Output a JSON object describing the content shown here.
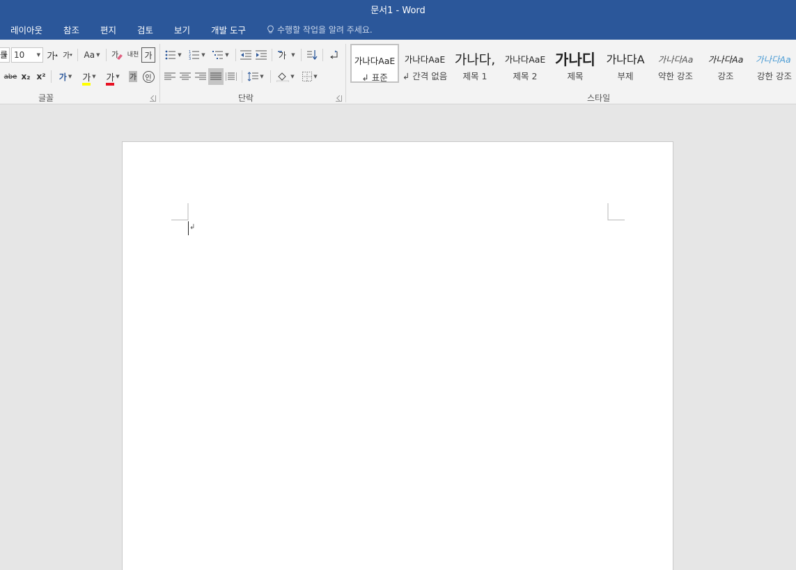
{
  "window": {
    "title": "문서1 - Word"
  },
  "menu": {
    "items": [
      "레이아웃",
      "참조",
      "편지",
      "검토",
      "보기",
      "개발 도구"
    ],
    "tell_me": "수행할 작업을 알려 주세요."
  },
  "font_group": {
    "label": "글꼴",
    "font_size": "10",
    "font_name_partial": "를",
    "grow_label": "가",
    "shrink_label": "가",
    "case_label": "Aa",
    "phonetic_label": "내천",
    "enclose_label": "가",
    "strike_label": "abe",
    "sub_label": "x₂",
    "sup_label": "x²",
    "text_effect_label": "가",
    "highlight_label": "가",
    "font_color_label": "가",
    "shading_label": "가",
    "circle_label": "인"
  },
  "paragraph_group": {
    "label": "단락"
  },
  "styles_group": {
    "label": "스타일",
    "items": [
      {
        "sample": "가나다AaE",
        "name": "↲ 표준"
      },
      {
        "sample": "가나다AaE",
        "name": "↲ 간격 없음"
      },
      {
        "sample": "가나다,",
        "name": "제목 1"
      },
      {
        "sample": "가나다AaE",
        "name": "제목 2"
      },
      {
        "sample": "가나디",
        "name": "제목"
      },
      {
        "sample": "가나다A",
        "name": "부제"
      },
      {
        "sample": "가나다Aa",
        "name": "약한 강조"
      },
      {
        "sample": "가나다Aa",
        "name": "강조"
      },
      {
        "sample": "가나다Aa",
        "name": "강한 강조"
      }
    ]
  },
  "colors": {
    "brand": "#2b579a",
    "highlight": "#ffff00",
    "font_color": "#e81123",
    "intense_emphasis": "#4a9bd4"
  },
  "document": {
    "paragraph_mark": "↲"
  }
}
